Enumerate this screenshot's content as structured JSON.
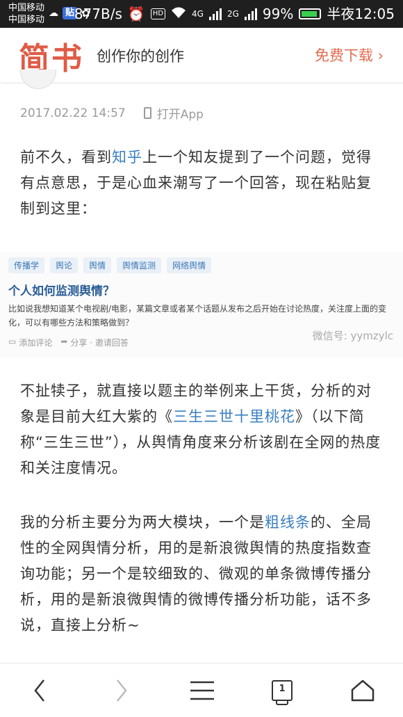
{
  "status_bar": {
    "carrier_1": "中国移动",
    "carrier_2": "中国移动",
    "app_badge": "贴",
    "speed": "877B/s",
    "hd": "HD",
    "net_4g": "4G",
    "net_2g": "2G",
    "battery": "99%",
    "time": "半夜12:05"
  },
  "header": {
    "logo": "简书",
    "slogan": "创作你的创作",
    "download": "免费下载 ›"
  },
  "article": {
    "date": "2017.02.22 14:57",
    "open_app": "打开App",
    "p1_a": "前不久，看到",
    "p1_link": "知乎",
    "p1_b": "上一个知友提到了一个问题，觉得有点意思，于是心血来潮写了一个回答，现在粘贴复制到这里：",
    "p2_a": "不扯犊子，就直接以题主的举例来上干货，分析的对象是目前大红大紫的《",
    "p2_link": "三生三世十里桃花",
    "p2_b": "》（以下简称“三生三世”），从舆情角度来分析该剧在全网的热度和关注度情况。",
    "p3_a": "我的分析主要分为两大模块，一个是",
    "p3_link": "粗线条",
    "p3_b": "的、全局性的全网舆情分析，用的是新浪微舆情的热度指数查询功能；另一个是较细致的、微观的单条微博传播分析，用的是新浪微舆情的微博传播分析功能，话不多说，直接上分析~"
  },
  "embedded_image": {
    "tags": [
      "传播学",
      "舆论",
      "舆情",
      "舆情监测",
      "网络舆情"
    ],
    "question_title": "个人如何监测舆情？",
    "question_desc": "比如说我想知道某个电视剧/电影，某篇文章或者某个话题从发布之后开始在讨论热度，关注度上面的变化，可以有哪些方法和策略做到？",
    "add_comment": "添加评论",
    "share": "分享 · 邀请回答",
    "wechat": "微信号: yymzylc"
  },
  "bottom_nav": {
    "tab_count": "1"
  }
}
